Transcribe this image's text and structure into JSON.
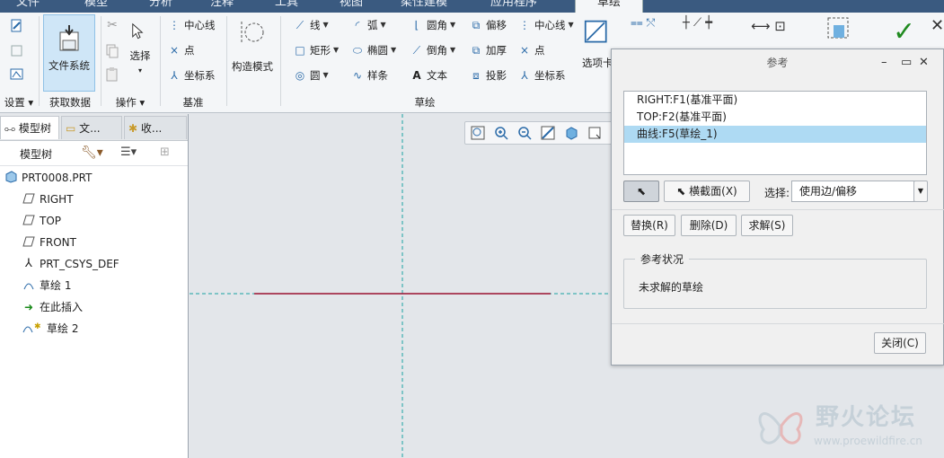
{
  "tabs": [
    "文件",
    "模型",
    "分析",
    "注释",
    "工具",
    "视图",
    "柔性建模",
    "应用程序",
    "草绘"
  ],
  "active_tab": "草绘",
  "ribbon": {
    "groups": [
      "设置",
      "获取数据",
      "操作",
      "基准",
      "草绘"
    ],
    "file_system": "文件系统",
    "select": "选择",
    "datum_items": [
      "中心线",
      "点",
      "坐标系"
    ],
    "construct_mode": "构造模式",
    "sketch_col1": [
      "线",
      "矩形",
      "圆"
    ],
    "sketch_col2": [
      "弧",
      "椭圆",
      "样条"
    ],
    "sketch_col3": [
      "圆角",
      "倒角",
      "文本"
    ],
    "sketch_col4": [
      "偏移",
      "加厚",
      "投影"
    ],
    "sketch_col5": [
      "中心线",
      "点",
      "坐标系"
    ],
    "select_view": "选项卡"
  },
  "left_panel": {
    "tabs": [
      "模型树",
      "文...",
      "收..."
    ],
    "toolbar_label": "模型树",
    "tree": [
      {
        "label": "PRT0008.PRT",
        "icon": "part-icon"
      },
      {
        "label": "RIGHT",
        "icon": "datum-plane-icon"
      },
      {
        "label": "TOP",
        "icon": "datum-plane-icon"
      },
      {
        "label": "FRONT",
        "icon": "datum-plane-icon"
      },
      {
        "label": "PRT_CSYS_DEF",
        "icon": "csys-icon"
      },
      {
        "label": "草绘 1",
        "icon": "sketch-icon"
      },
      {
        "label": "在此插入",
        "icon": "insert-arrow-icon"
      },
      {
        "label": "草绘 2",
        "icon": "sketch-new-icon"
      }
    ]
  },
  "dialog": {
    "title": "参考",
    "references": [
      "RIGHT:F1(基准平面)",
      "TOP:F2(基准平面)",
      "曲线:F5(草绘_1)"
    ],
    "selected_index": 2,
    "cross_section_btn": "横截面(X)",
    "select_label": "选择:",
    "select_value": "使用边/偏移",
    "replace_btn": "替换(R)",
    "delete_btn": "删除(D)",
    "solve_btn": "求解(S)",
    "status_legend": "参考状况",
    "status_text": "未求解的草绘",
    "close_btn": "关闭(C)"
  },
  "watermark": {
    "title": "野火论坛",
    "url": "www.proewildfire.cn"
  },
  "colors": {
    "accent": "#2a6aa8",
    "selection": "#aedaf3",
    "curve": "#9a1030",
    "centerline": "#1aa3a3"
  }
}
